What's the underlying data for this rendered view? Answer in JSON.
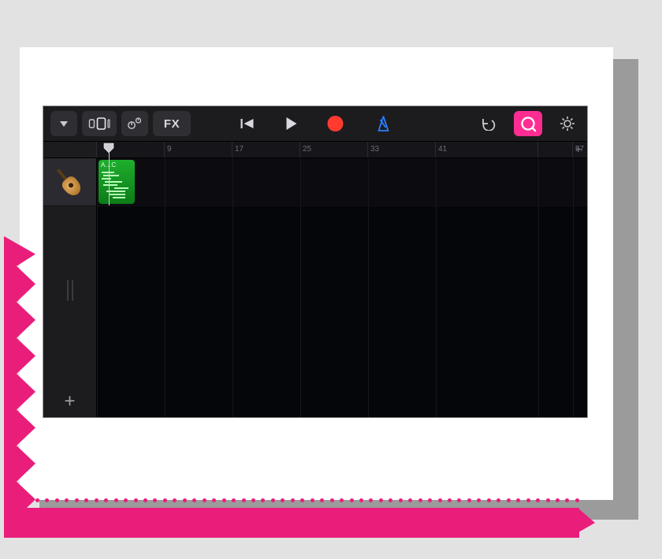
{
  "toolbar": {
    "browser_icon": "browser-triangle-icon",
    "view_icon": "tracks-view-icon",
    "automation_icon": "track-controls-icon",
    "fx_label": "FX",
    "rewind_icon": "rewind-icon",
    "play_icon": "play-icon",
    "record_icon": "record-icon",
    "metronome_icon": "metronome-icon",
    "undo_icon": "undo-icon",
    "loop_icon": "loop-browser-icon",
    "settings_icon": "settings-gear-icon"
  },
  "ruler": {
    "ticks": [
      {
        "pos": 0,
        "label": ""
      },
      {
        "pos": 86,
        "label": "9"
      },
      {
        "pos": 172,
        "label": "17"
      },
      {
        "pos": 258,
        "label": "25"
      },
      {
        "pos": 344,
        "label": "33"
      },
      {
        "pos": 430,
        "label": "41"
      },
      {
        "pos": 560,
        "label": ""
      },
      {
        "pos": 604,
        "label": "57"
      }
    ],
    "add_label": "+"
  },
  "tracks": {
    "add_label": "+",
    "items": [
      {
        "instrument": "acoustic-guitar",
        "region_label": "A…C"
      }
    ]
  },
  "colors": {
    "accent_pink": "#ff2d92",
    "record_red": "#ff3b30",
    "metronome_blue": "#2d7dff",
    "region_green": "#17a324"
  }
}
